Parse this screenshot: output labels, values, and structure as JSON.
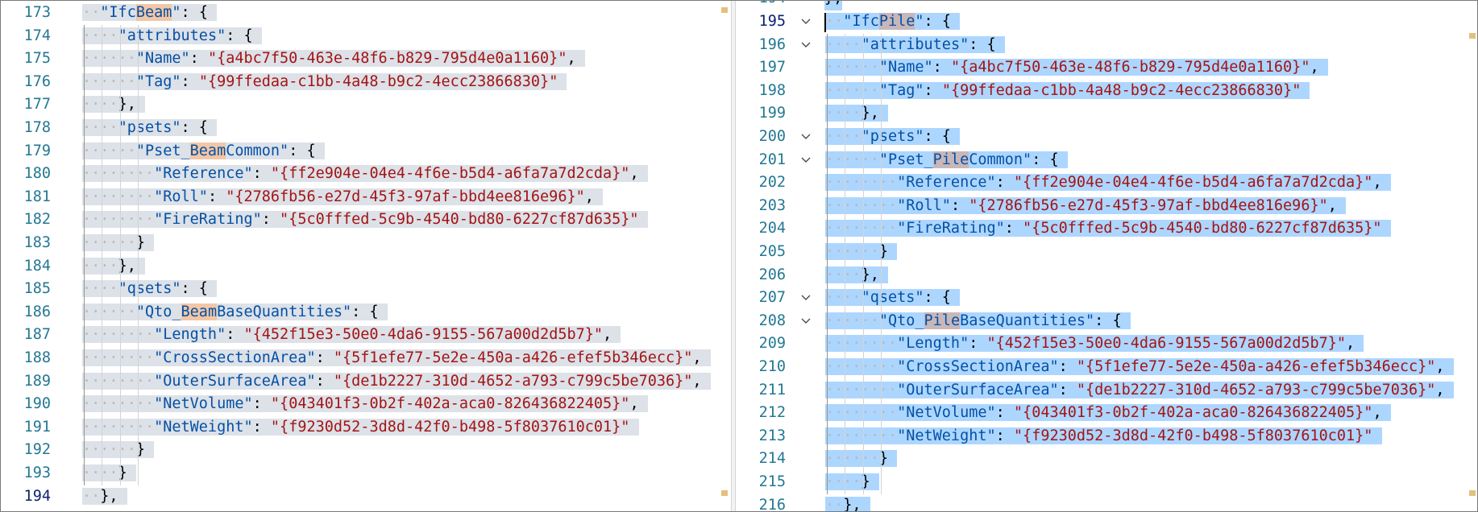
{
  "left_pane": {
    "lines": [
      {
        "n": "173",
        "indent": 1,
        "parts": [
          {
            "t": "\"Ifc",
            "c": "key"
          },
          {
            "t": "Beam",
            "c": "key hl-left"
          },
          {
            "t": "\"",
            "c": "key"
          },
          {
            "t": ": {",
            "c": "pun"
          }
        ]
      },
      {
        "n": "174",
        "indent": 2,
        "parts": [
          {
            "t": "\"attributes\"",
            "c": "key"
          },
          {
            "t": ": {",
            "c": "pun"
          }
        ]
      },
      {
        "n": "175",
        "indent": 3,
        "parts": [
          {
            "t": "\"Name\"",
            "c": "key"
          },
          {
            "t": ": ",
            "c": "pun"
          },
          {
            "t": "\"{a4bc7f50-463e-48f6-b829-795d4e0a1160}\"",
            "c": "str"
          },
          {
            "t": ",",
            "c": "pun"
          }
        ]
      },
      {
        "n": "176",
        "indent": 3,
        "parts": [
          {
            "t": "\"Tag\"",
            "c": "key"
          },
          {
            "t": ": ",
            "c": "pun"
          },
          {
            "t": "\"{99ffedaa-c1bb-4a48-b9c2-4ecc23866830}\"",
            "c": "str"
          }
        ]
      },
      {
        "n": "177",
        "indent": 2,
        "parts": [
          {
            "t": "},",
            "c": "pun"
          }
        ]
      },
      {
        "n": "178",
        "indent": 2,
        "parts": [
          {
            "t": "\"psets\"",
            "c": "key"
          },
          {
            "t": ": {",
            "c": "pun"
          }
        ]
      },
      {
        "n": "179",
        "indent": 3,
        "parts": [
          {
            "t": "\"Pset_",
            "c": "key"
          },
          {
            "t": "Beam",
            "c": "key hl-left"
          },
          {
            "t": "Common\"",
            "c": "key"
          },
          {
            "t": ": {",
            "c": "pun"
          }
        ]
      },
      {
        "n": "180",
        "indent": 4,
        "parts": [
          {
            "t": "\"Reference\"",
            "c": "key"
          },
          {
            "t": ": ",
            "c": "pun"
          },
          {
            "t": "\"{ff2e904e-04e4-4f6e-b5d4-a6fa7a7d2cda}\"",
            "c": "str"
          },
          {
            "t": ",",
            "c": "pun"
          }
        ]
      },
      {
        "n": "181",
        "indent": 4,
        "parts": [
          {
            "t": "\"Roll\"",
            "c": "key"
          },
          {
            "t": ": ",
            "c": "pun"
          },
          {
            "t": "\"{2786fb56-e27d-45f3-97af-bbd4ee816e96}\"",
            "c": "str"
          },
          {
            "t": ",",
            "c": "pun"
          }
        ]
      },
      {
        "n": "182",
        "indent": 4,
        "parts": [
          {
            "t": "\"FireRating\"",
            "c": "key"
          },
          {
            "t": ": ",
            "c": "pun"
          },
          {
            "t": "\"{5c0fffed-5c9b-4540-bd80-6227cf87d635}\"",
            "c": "str"
          }
        ]
      },
      {
        "n": "183",
        "indent": 3,
        "parts": [
          {
            "t": "}",
            "c": "pun"
          }
        ]
      },
      {
        "n": "184",
        "indent": 2,
        "parts": [
          {
            "t": "},",
            "c": "pun"
          }
        ]
      },
      {
        "n": "185",
        "indent": 2,
        "parts": [
          {
            "t": "\"qsets\"",
            "c": "key"
          },
          {
            "t": ": {",
            "c": "pun"
          }
        ]
      },
      {
        "n": "186",
        "indent": 3,
        "parts": [
          {
            "t": "\"Qto_",
            "c": "key"
          },
          {
            "t": "Beam",
            "c": "key hl-left"
          },
          {
            "t": "BaseQuantities\"",
            "c": "key"
          },
          {
            "t": ": {",
            "c": "pun"
          }
        ]
      },
      {
        "n": "187",
        "indent": 4,
        "parts": [
          {
            "t": "\"Length\"",
            "c": "key"
          },
          {
            "t": ": ",
            "c": "pun"
          },
          {
            "t": "\"{452f15e3-50e0-4da6-9155-567a00d2d5b7}\"",
            "c": "str"
          },
          {
            "t": ",",
            "c": "pun"
          }
        ]
      },
      {
        "n": "188",
        "indent": 4,
        "parts": [
          {
            "t": "\"CrossSectionArea\"",
            "c": "key"
          },
          {
            "t": ": ",
            "c": "pun"
          },
          {
            "t": "\"{5f1efe77-5e2e-450a-a426-efef5b346ecc}\"",
            "c": "str"
          },
          {
            "t": ",",
            "c": "pun"
          }
        ]
      },
      {
        "n": "189",
        "indent": 4,
        "parts": [
          {
            "t": "\"OuterSurfaceArea\"",
            "c": "key"
          },
          {
            "t": ": ",
            "c": "pun"
          },
          {
            "t": "\"{de1b2227-310d-4652-a793-c799c5be7036}\"",
            "c": "str"
          },
          {
            "t": ",",
            "c": "pun"
          }
        ]
      },
      {
        "n": "190",
        "indent": 4,
        "parts": [
          {
            "t": "\"NetVolume\"",
            "c": "key"
          },
          {
            "t": ": ",
            "c": "pun"
          },
          {
            "t": "\"{043401f3-0b2f-402a-aca0-826436822405}\"",
            "c": "str"
          },
          {
            "t": ",",
            "c": "pun"
          }
        ]
      },
      {
        "n": "191",
        "indent": 4,
        "parts": [
          {
            "t": "\"NetWeight\"",
            "c": "key"
          },
          {
            "t": ": ",
            "c": "pun"
          },
          {
            "t": "\"{f9230d52-3d8d-42f0-b498-5f8037610c01}\"",
            "c": "str"
          }
        ]
      },
      {
        "n": "192",
        "indent": 3,
        "parts": [
          {
            "t": "}",
            "c": "pun"
          }
        ]
      },
      {
        "n": "193",
        "indent": 2,
        "parts": [
          {
            "t": "}",
            "c": "pun"
          }
        ]
      },
      {
        "n": "194",
        "indent": 1,
        "parts": [
          {
            "t": "},",
            "c": "pun"
          }
        ],
        "current": true
      }
    ]
  },
  "right_pane": {
    "top_partial": "},",
    "lines": [
      {
        "n": "195",
        "indent": 1,
        "fold": true,
        "parts": [
          {
            "t": "\"Ifc",
            "c": "key"
          },
          {
            "t": "Pile",
            "c": "key hl-right"
          },
          {
            "t": "\"",
            "c": "key"
          },
          {
            "t": ": {",
            "c": "pun"
          }
        ],
        "current": true
      },
      {
        "n": "196",
        "indent": 2,
        "fold": true,
        "parts": [
          {
            "t": "\"attributes\"",
            "c": "key"
          },
          {
            "t": ": {",
            "c": "pun"
          }
        ]
      },
      {
        "n": "197",
        "indent": 3,
        "parts": [
          {
            "t": "\"Name\"",
            "c": "key"
          },
          {
            "t": ": ",
            "c": "pun"
          },
          {
            "t": "\"{a4bc7f50-463e-48f6-b829-795d4e0a1160}\"",
            "c": "str"
          },
          {
            "t": ",",
            "c": "pun"
          }
        ]
      },
      {
        "n": "198",
        "indent": 3,
        "parts": [
          {
            "t": "\"Tag\"",
            "c": "key"
          },
          {
            "t": ": ",
            "c": "pun"
          },
          {
            "t": "\"{99ffedaa-c1bb-4a48-b9c2-4ecc23866830}\"",
            "c": "str"
          }
        ]
      },
      {
        "n": "199",
        "indent": 2,
        "parts": [
          {
            "t": "},",
            "c": "pun"
          }
        ]
      },
      {
        "n": "200",
        "indent": 2,
        "fold": true,
        "parts": [
          {
            "t": "\"psets\"",
            "c": "key"
          },
          {
            "t": ": {",
            "c": "pun"
          }
        ]
      },
      {
        "n": "201",
        "indent": 3,
        "fold": true,
        "parts": [
          {
            "t": "\"Pset_",
            "c": "key"
          },
          {
            "t": "Pile",
            "c": "key hl-right"
          },
          {
            "t": "Common\"",
            "c": "key"
          },
          {
            "t": ": {",
            "c": "pun"
          }
        ]
      },
      {
        "n": "202",
        "indent": 4,
        "parts": [
          {
            "t": "\"Reference\"",
            "c": "key"
          },
          {
            "t": ": ",
            "c": "pun"
          },
          {
            "t": "\"{ff2e904e-04e4-4f6e-b5d4-a6fa7a7d2cda}\"",
            "c": "str"
          },
          {
            "t": ",",
            "c": "pun"
          }
        ]
      },
      {
        "n": "203",
        "indent": 4,
        "parts": [
          {
            "t": "\"Roll\"",
            "c": "key"
          },
          {
            "t": ": ",
            "c": "pun"
          },
          {
            "t": "\"{2786fb56-e27d-45f3-97af-bbd4ee816e96}\"",
            "c": "str"
          },
          {
            "t": ",",
            "c": "pun"
          }
        ]
      },
      {
        "n": "204",
        "indent": 4,
        "parts": [
          {
            "t": "\"FireRating\"",
            "c": "key"
          },
          {
            "t": ": ",
            "c": "pun"
          },
          {
            "t": "\"{5c0fffed-5c9b-4540-bd80-6227cf87d635}\"",
            "c": "str"
          }
        ]
      },
      {
        "n": "205",
        "indent": 3,
        "parts": [
          {
            "t": "}",
            "c": "pun"
          }
        ]
      },
      {
        "n": "206",
        "indent": 2,
        "parts": [
          {
            "t": "},",
            "c": "pun"
          }
        ]
      },
      {
        "n": "207",
        "indent": 2,
        "fold": true,
        "parts": [
          {
            "t": "\"qsets\"",
            "c": "key"
          },
          {
            "t": ": {",
            "c": "pun"
          }
        ]
      },
      {
        "n": "208",
        "indent": 3,
        "fold": true,
        "parts": [
          {
            "t": "\"Qto_",
            "c": "key"
          },
          {
            "t": "Pile",
            "c": "key hl-right"
          },
          {
            "t": "BaseQuantities\"",
            "c": "key"
          },
          {
            "t": ": {",
            "c": "pun"
          }
        ]
      },
      {
        "n": "209",
        "indent": 4,
        "parts": [
          {
            "t": "\"Length\"",
            "c": "key"
          },
          {
            "t": ": ",
            "c": "pun"
          },
          {
            "t": "\"{452f15e3-50e0-4da6-9155-567a00d2d5b7}\"",
            "c": "str"
          },
          {
            "t": ",",
            "c": "pun"
          }
        ]
      },
      {
        "n": "210",
        "indent": 4,
        "parts": [
          {
            "t": "\"CrossSectionArea\"",
            "c": "key"
          },
          {
            "t": ": ",
            "c": "pun"
          },
          {
            "t": "\"{5f1efe77-5e2e-450a-a426-efef5b346ecc}\"",
            "c": "str"
          },
          {
            "t": ",",
            "c": "pun"
          }
        ]
      },
      {
        "n": "211",
        "indent": 4,
        "parts": [
          {
            "t": "\"OuterSurfaceArea\"",
            "c": "key"
          },
          {
            "t": ": ",
            "c": "pun"
          },
          {
            "t": "\"{de1b2227-310d-4652-a793-c799c5be7036}\"",
            "c": "str"
          },
          {
            "t": ",",
            "c": "pun"
          }
        ]
      },
      {
        "n": "212",
        "indent": 4,
        "parts": [
          {
            "t": "\"NetVolume\"",
            "c": "key"
          },
          {
            "t": ": ",
            "c": "pun"
          },
          {
            "t": "\"{043401f3-0b2f-402a-aca0-826436822405}\"",
            "c": "str"
          },
          {
            "t": ",",
            "c": "pun"
          }
        ]
      },
      {
        "n": "213",
        "indent": 4,
        "parts": [
          {
            "t": "\"NetWeight\"",
            "c": "key"
          },
          {
            "t": ": ",
            "c": "pun"
          },
          {
            "t": "\"{f9230d52-3d8d-42f0-b498-5f8037610c01}\"",
            "c": "str"
          }
        ]
      },
      {
        "n": "214",
        "indent": 3,
        "parts": [
          {
            "t": "}",
            "c": "pun"
          }
        ]
      },
      {
        "n": "215",
        "indent": 2,
        "parts": [
          {
            "t": "}",
            "c": "pun"
          }
        ]
      },
      {
        "n": "216",
        "indent": 1,
        "parts": [
          {
            "t": "},",
            "c": "pun"
          }
        ]
      }
    ]
  },
  "icons": {
    "fold_open": "chevron-down-icon",
    "overview_marker": "overview-ruler-marker"
  },
  "colors": {
    "line_number": "#237893",
    "json_key": "#0451a5",
    "json_string": "#a31515",
    "selection_inactive": "#dde1e8",
    "selection_active": "#add6ff",
    "find_match_left": "#f2c6a6",
    "find_match_right": "#c7b7ba"
  }
}
